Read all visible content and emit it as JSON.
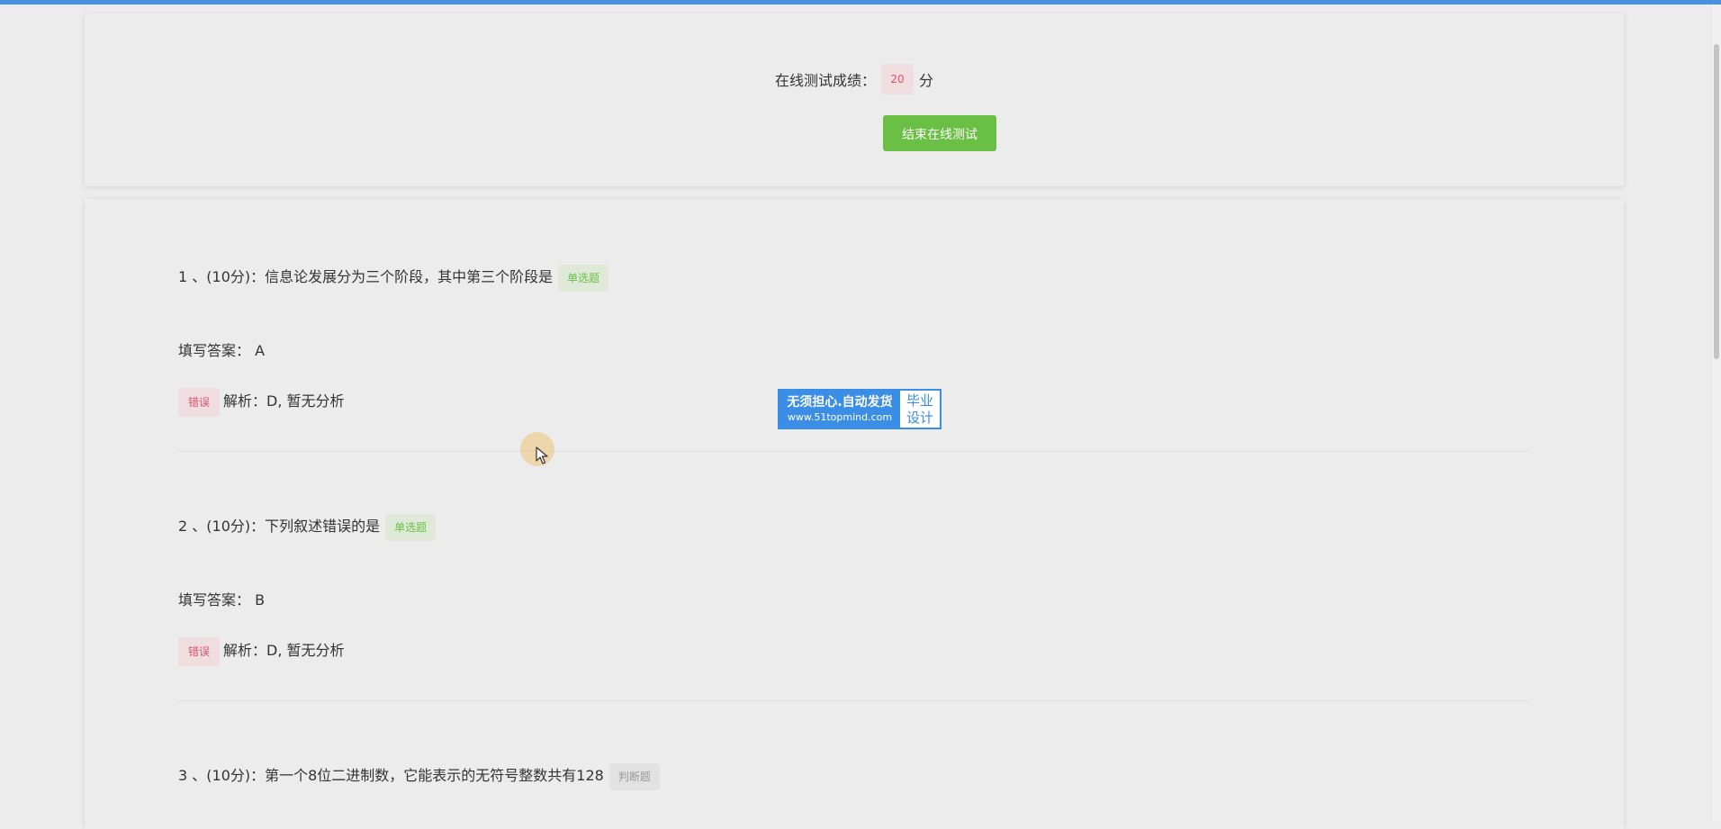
{
  "score_panel": {
    "label": "在线测试成绩：",
    "score": "20",
    "unit": "分",
    "end_button": "结束在线测试"
  },
  "questions": [
    {
      "title": "1 、(10分)：信息论发展分为三个阶段，其中第三个阶段是",
      "type_tag": "单选题",
      "answer": "填写答案： A",
      "result": "错误",
      "analysis": "解析：D, 暂无分析"
    },
    {
      "title": "2 、(10分)：下列叙述错误的是",
      "type_tag": "单选题",
      "answer": "填写答案： B",
      "result": "错误",
      "analysis": "解析：D, 暂无分析"
    },
    {
      "title": "3 、(10分)：第一个8位二进制数，它能表示的无符号整数共有128",
      "type_tag": "判断题"
    }
  ],
  "watermark": {
    "line1": "无须担心.自动发货",
    "line2": "www.51topmind.com",
    "right1": "毕业",
    "right2": "设计"
  },
  "colors": {
    "top_bar": "#4a90e2",
    "button_green": "#6ac044",
    "wrong_red": "#e0546b",
    "watermark_blue": "#3a8ee6"
  }
}
